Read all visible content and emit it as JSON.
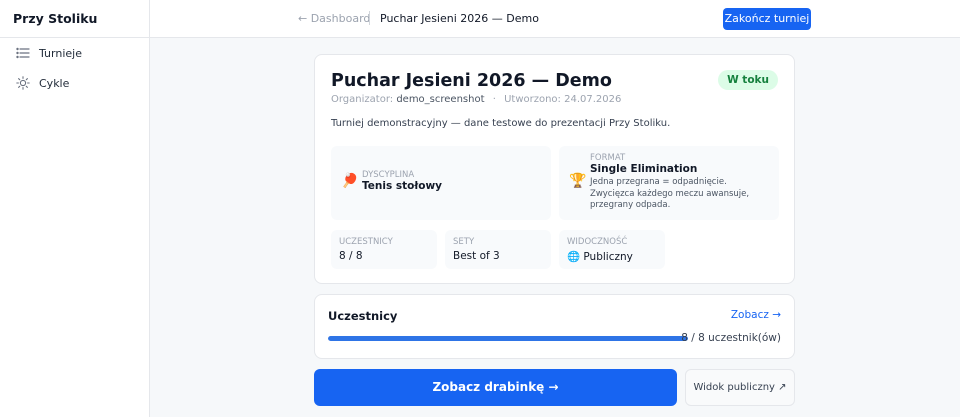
{
  "app": {
    "brand": "Przy Stoliku"
  },
  "sidebar": {
    "items": [
      {
        "label": "Turnieje",
        "icon": "list-icon"
      },
      {
        "label": "Cykle",
        "icon": "sun-icon"
      }
    ]
  },
  "topbar": {
    "back": "← Dashboard",
    "title": "Puchar Jesieni 2026 — Demo",
    "end_button": "Zakończ turniej"
  },
  "tournament": {
    "title": "Puchar Jesieni 2026 — Demo",
    "status": "W toku",
    "organizer_label": "Organizator:",
    "organizer": "demo_screenshot",
    "separator": "·",
    "created_label": "Utworzono:",
    "created": "24.07.2026",
    "description": "Turniej demonstracyjny — dane testowe do prezentacji Przy Stoliku.",
    "discipline": {
      "label": "DYSCYPLINA",
      "value": "Tenis stołowy",
      "emoji": "🏓"
    },
    "format": {
      "label": "FORMAT",
      "value": "Single Elimination",
      "emoji": "🏆",
      "description": "Jedna przegrana = odpadnięcie. Zwycięzca każdego meczu awansuje, przegrany odpada."
    },
    "stats": [
      {
        "label": "UCZESTNICY",
        "value": "8 / 8"
      },
      {
        "label": "SETY",
        "value": "Best of 3"
      },
      {
        "label": "WIDOCZNOŚĆ",
        "value": "🌐 Publiczny"
      }
    ]
  },
  "participants": {
    "title": "Uczestnicy",
    "link": "Zobacz →",
    "progress": 1.0,
    "count_text": "8 / 8 uczestnik(ów)"
  },
  "actions": {
    "bracket": "Zobacz drabinkę →",
    "public_view": "Widok publiczny ↗"
  },
  "colors": {
    "accent": "#1764f2",
    "status_bg": "#dcfce7",
    "status_text": "#15803d",
    "progress": "#2e74e6"
  }
}
